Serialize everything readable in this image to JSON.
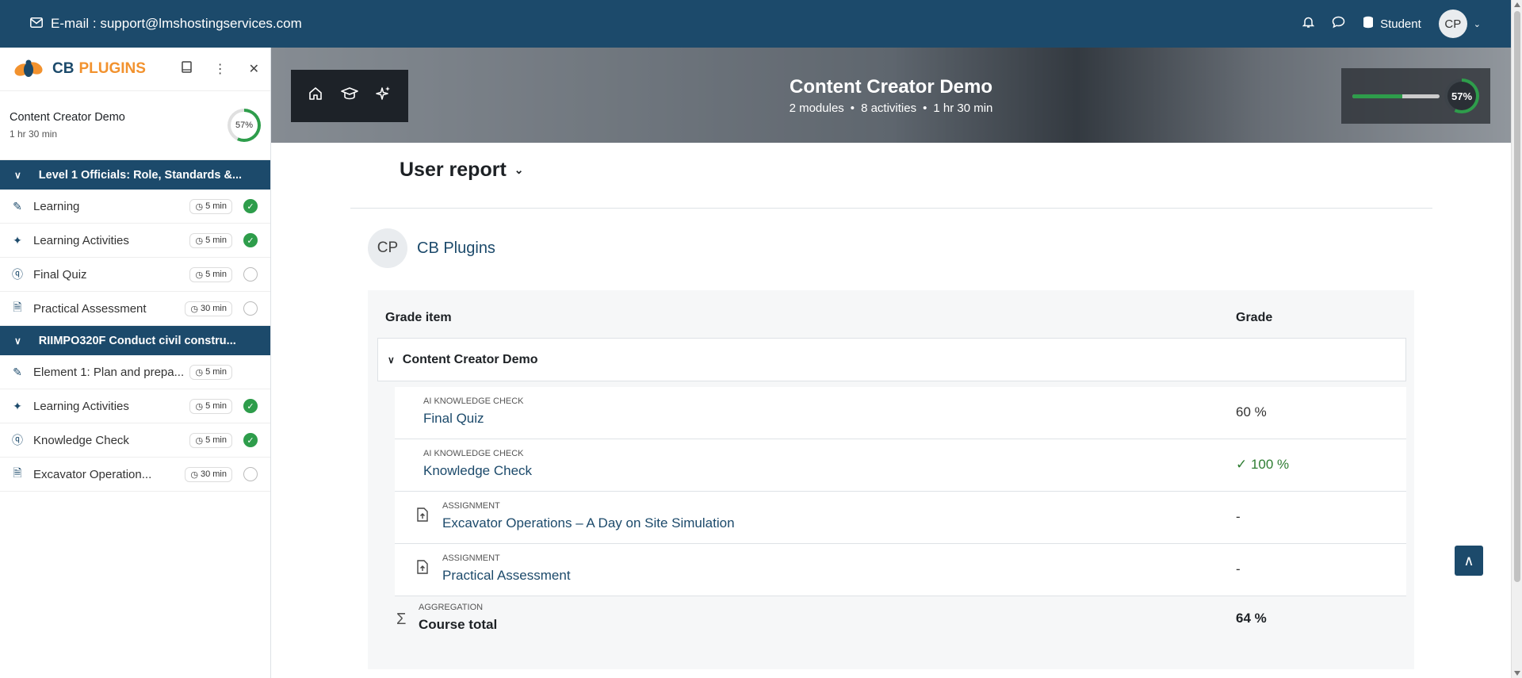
{
  "topbar": {
    "email": "E-mail : support@lmshostingservices.com",
    "role": "Student",
    "avatar": "CP"
  },
  "sidebar": {
    "logo_cb": "CB",
    "logo_plugins": "PLUGINS",
    "course_title": "Content Creator Demo",
    "course_duration": "1 hr 30 min",
    "progress": "57%",
    "sections": [
      {
        "title": "Level 1 Officials: Role, Standards &...",
        "activities": [
          {
            "label": "Learning",
            "duration": "5 min",
            "done": true
          },
          {
            "label": "Learning Activities",
            "duration": "5 min",
            "done": true
          },
          {
            "label": "Final Quiz",
            "duration": "5 min",
            "done": false
          },
          {
            "label": "Practical Assessment",
            "duration": "30 min",
            "done": false
          }
        ]
      },
      {
        "title": "RIIMPO320F Conduct civil constru...",
        "activities": [
          {
            "label": "Element 1: Plan and prepa...",
            "duration": "5 min",
            "done": null
          },
          {
            "label": "Learning Activities",
            "duration": "5 min",
            "done": true
          },
          {
            "label": "Knowledge Check",
            "duration": "5 min",
            "done": true
          },
          {
            "label": "Excavator Operation...",
            "duration": "30 min",
            "done": false
          }
        ]
      }
    ]
  },
  "banner": {
    "title": "Content Creator Demo",
    "modules": "2 modules",
    "activities": "8 activities",
    "duration": "1 hr 30 min",
    "progress": "57%",
    "progress_fraction": 0.57
  },
  "report": {
    "heading": "User report",
    "user_initials": "CP",
    "user_name": "CB Plugins",
    "col_item": "Grade item",
    "col_grade": "Grade",
    "category": "Content Creator Demo",
    "items": [
      {
        "type": "AI KNOWLEDGE CHECK",
        "name": "Final Quiz",
        "grade": "60 %",
        "ok": false,
        "file_icon": false
      },
      {
        "type": "AI KNOWLEDGE CHECK",
        "name": "Knowledge Check",
        "grade": "100 %",
        "ok": true,
        "file_icon": false
      },
      {
        "type": "ASSIGNMENT",
        "name": "Excavator Operations – A Day on Site Simulation",
        "grade": "-",
        "ok": false,
        "file_icon": true
      },
      {
        "type": "ASSIGNMENT",
        "name": "Practical Assessment",
        "grade": "-",
        "ok": false,
        "file_icon": true
      }
    ],
    "total_type": "AGGREGATION",
    "total_name": "Course total",
    "total_grade": "64 %"
  },
  "colors": {
    "brand": "#1c4a6b",
    "accent": "#f2922e",
    "success": "#2e9d4b"
  }
}
